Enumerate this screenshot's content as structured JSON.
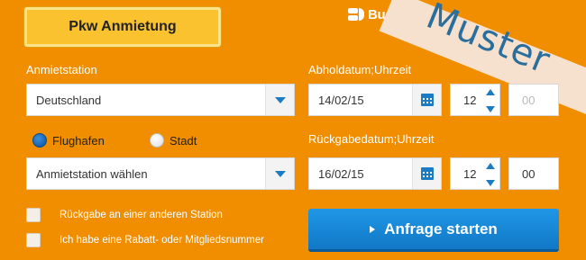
{
  "tab": {
    "label": "Pkw Anmietung"
  },
  "brand": {
    "logo_text": "Budget"
  },
  "watermark": {
    "text": "Muster"
  },
  "pickup_station": {
    "label": "Anmietstation",
    "country_value": "Deutschland",
    "location_type_options": [
      "Flughafen",
      "Stadt"
    ],
    "location_type_selected": "Flughafen",
    "station_value": "Anmietstation wählen"
  },
  "pickup_datetime": {
    "label": "Abholdatum;Uhrzeit",
    "date": "14/02/15",
    "hour": "12",
    "minute": "00"
  },
  "return_datetime": {
    "label": "Rückgabedatum;Uhrzeit",
    "date": "16/02/15",
    "hour": "12",
    "minute": "00"
  },
  "options": {
    "return_other_station": "Rückgabe an einer anderen Station",
    "discount_member": "Ich habe eine Rabatt- oder Mitgliedsnummer"
  },
  "submit": {
    "label": "Anfrage starten"
  },
  "colors": {
    "background": "#f18e00",
    "tab": "#f9c22e",
    "accent_blue": "#1b7cc4",
    "watermark_band": "#f6e0ce",
    "watermark_text": "#2a6e9e"
  }
}
